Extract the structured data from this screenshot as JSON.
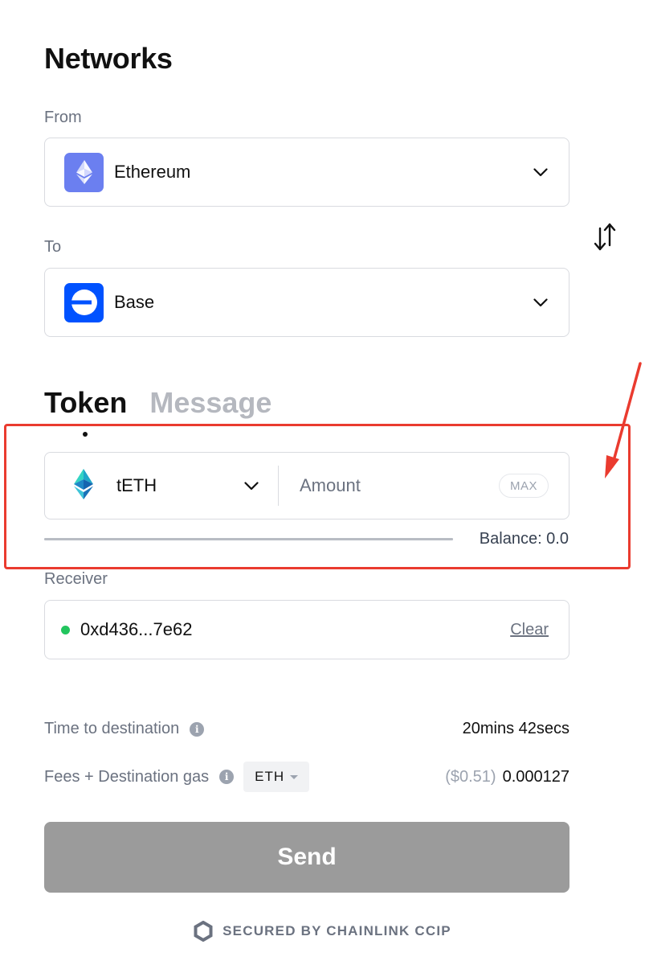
{
  "networks": {
    "heading": "Networks",
    "from_label": "From",
    "from_network": {
      "name": "Ethereum",
      "icon": "ethereum-icon",
      "color": "#6b7ff0"
    },
    "to_label": "To",
    "to_network": {
      "name": "Base",
      "icon": "base-icon",
      "color": "#0052ff"
    },
    "swap_icon": "swap-arrows-icon"
  },
  "tabs": [
    {
      "label": "Token",
      "active": true
    },
    {
      "label": "Message",
      "active": false
    }
  ],
  "token": {
    "name": "tETH",
    "icon": "teth-icon",
    "amount_placeholder": "Amount",
    "max_label": "MAX",
    "balance": "Balance: 0.0",
    "balance_fill": 1.0
  },
  "receiver": {
    "label": "Receiver",
    "address": "0xd436...7e62",
    "clear_label": "Clear",
    "status_color": "#22c55e"
  },
  "details": {
    "time_label": "Time to destination",
    "time_value": "20mins 42secs",
    "fees_label": "Fees + Destination gas",
    "fee_token": "ETH",
    "fee_usd": "($0.51)",
    "fee_amount": "0.000127"
  },
  "send_label": "Send",
  "footer": "SECURED BY CHAINLINK CCIP",
  "annotation_color": "#ea3b2f"
}
